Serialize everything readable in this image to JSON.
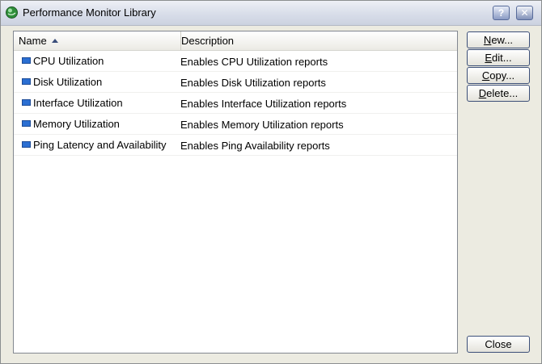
{
  "window": {
    "title": "Performance Monitor Library",
    "help_label": "?",
    "close_glyph": "✕"
  },
  "columns": {
    "name": "Name",
    "description": "Description"
  },
  "rows": [
    {
      "name": "CPU Utilization",
      "description": "Enables CPU Utilization reports"
    },
    {
      "name": "Disk Utilization",
      "description": "Enables Disk Utilization reports"
    },
    {
      "name": "Interface Utilization",
      "description": "Enables Interface Utilization reports"
    },
    {
      "name": "Memory Utilization",
      "description": "Enables Memory Utilization reports"
    },
    {
      "name": "Ping Latency and Availability",
      "description": "Enables Ping Availability reports"
    }
  ],
  "buttons": {
    "new_key": "N",
    "new_rest": "ew...",
    "edit_key": "E",
    "edit_rest": "dit...",
    "copy_key": "C",
    "copy_rest": "opy...",
    "delete_key": "D",
    "delete_rest": "elete...",
    "close": "Close"
  }
}
